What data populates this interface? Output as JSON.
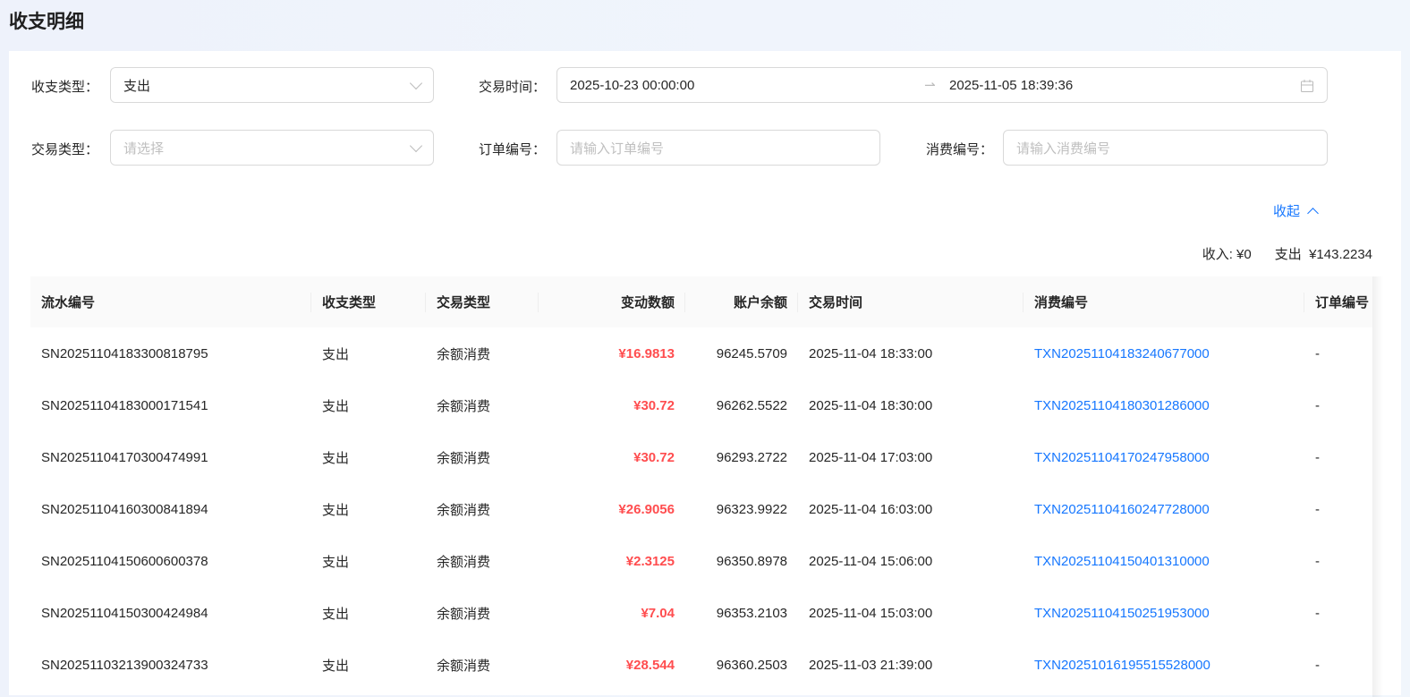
{
  "page_title": "收支明细",
  "filters": {
    "type_label": "收支类型：",
    "type_value": "支出",
    "time_label": "交易时间：",
    "time_start": "2025-10-23 00:00:00",
    "time_end": "2025-11-05 18:39:36",
    "trade_type_label": "交易类型：",
    "trade_type_placeholder": "请选择",
    "order_label": "订单编号：",
    "order_placeholder": "请输入订单编号",
    "consume_label": "消费编号：",
    "consume_placeholder": "请输入消费编号",
    "collapse_label": "收起"
  },
  "summary": {
    "income_label": "收入:",
    "income_value": "¥0",
    "expense_label": "支出",
    "expense_value": "¥143.2234"
  },
  "table": {
    "headers": [
      "流水编号",
      "收支类型",
      "交易类型",
      "变动数额",
      "账户余额",
      "交易时间",
      "消费编号",
      "订单编号"
    ],
    "rows": [
      [
        "SN20251104183300818795",
        "支出",
        "余额消费",
        "¥16.9813",
        "96245.5709",
        "2025-11-04 18:33:00",
        "TXN20251104183240677000",
        "-"
      ],
      [
        "SN20251104183000171541",
        "支出",
        "余额消费",
        "¥30.72",
        "96262.5522",
        "2025-11-04 18:30:00",
        "TXN20251104180301286000",
        "-"
      ],
      [
        "SN20251104170300474991",
        "支出",
        "余额消费",
        "¥30.72",
        "96293.2722",
        "2025-11-04 17:03:00",
        "TXN20251104170247958000",
        "-"
      ],
      [
        "SN20251104160300841894",
        "支出",
        "余额消费",
        "¥26.9056",
        "96323.9922",
        "2025-11-04 16:03:00",
        "TXN20251104160247728000",
        "-"
      ],
      [
        "SN20251104150600600378",
        "支出",
        "余额消费",
        "¥2.3125",
        "96350.8978",
        "2025-11-04 15:06:00",
        "TXN20251104150401310000",
        "-"
      ],
      [
        "SN20251104150300424984",
        "支出",
        "余额消费",
        "¥7.04",
        "96353.2103",
        "2025-11-04 15:03:00",
        "TXN20251104150251953000",
        "-"
      ],
      [
        "SN20251103213900324733",
        "支出",
        "余额消费",
        "¥28.544",
        "96360.2503",
        "2025-11-03 21:39:00",
        "TXN20251016195515528000",
        "-"
      ]
    ]
  }
}
